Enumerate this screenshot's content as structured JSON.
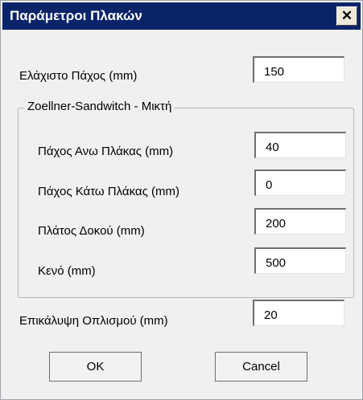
{
  "window": {
    "title": "Παράμετροι Πλακών",
    "close_symbol": "✕",
    "close_icon": "close-icon"
  },
  "fields": {
    "min_thickness": {
      "label": "Ελάχιστο Πάχος (mm)",
      "value": "150"
    },
    "cover": {
      "label": "Επικάλυψη Οπλισμού (mm)",
      "value": "20"
    }
  },
  "group": {
    "title": "Zoellner-Sandwitch - Μικτή",
    "top_slab": {
      "label": "Πάχος Ανω Πλάκας (mm)",
      "value": "40"
    },
    "bottom_slab": {
      "label": "Πάχος Κάτω Πλάκας (mm)",
      "value": "0"
    },
    "beam_width": {
      "label": "Πλάτος Δοκού (mm)",
      "value": "200"
    },
    "void": {
      "label": "Κενό (mm)",
      "value": "500"
    }
  },
  "buttons": {
    "ok": "OK",
    "cancel": "Cancel"
  },
  "colors": {
    "titlebar": "#0a246a",
    "dialog_bg": "#f0f0f0"
  }
}
